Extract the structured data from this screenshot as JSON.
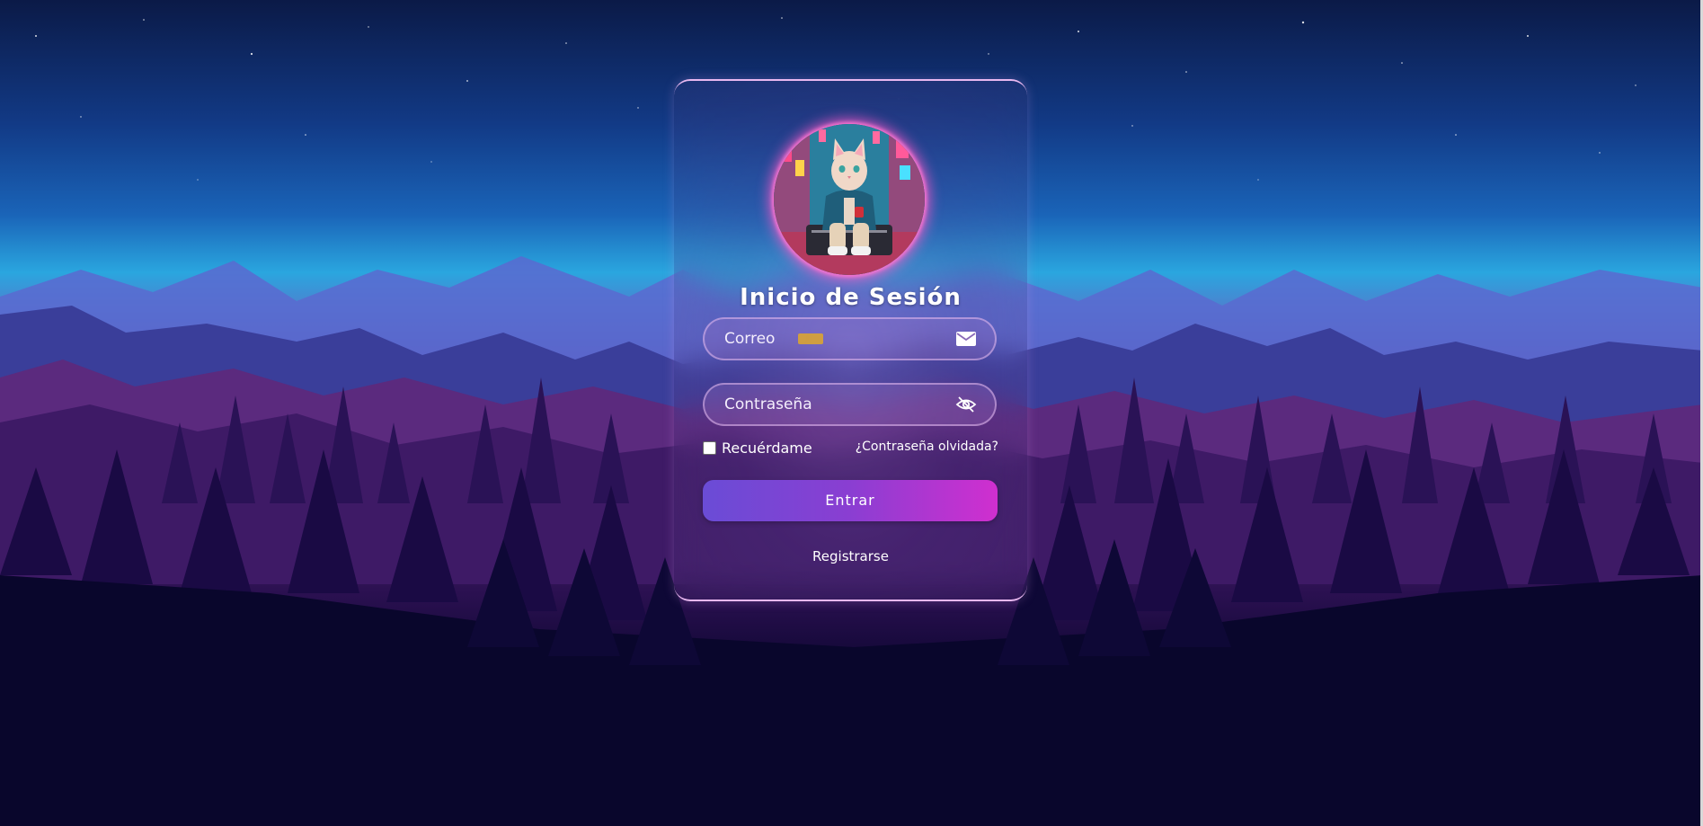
{
  "page": {
    "background_style": "night mountain forest landscape",
    "accent_colors": {
      "button_gradient_start": "#6a4cd6",
      "button_gradient_end": "#d02fcf",
      "avatar_glow": "#ff5ac8",
      "card_border": "#e8b8f0"
    }
  },
  "login": {
    "avatar_image": "cat-avatar",
    "title": "Inicio de Sesión",
    "email": {
      "placeholder": "Correo",
      "icon": "envelope-icon"
    },
    "password": {
      "placeholder": "Contraseña",
      "icon": "eye-slash-icon"
    },
    "remember_label": "Recuérdame",
    "remember_checked": false,
    "forgot_link": "¿Contraseña olvidada?",
    "submit_label": "Entrar",
    "register_link": "Registrarse"
  }
}
